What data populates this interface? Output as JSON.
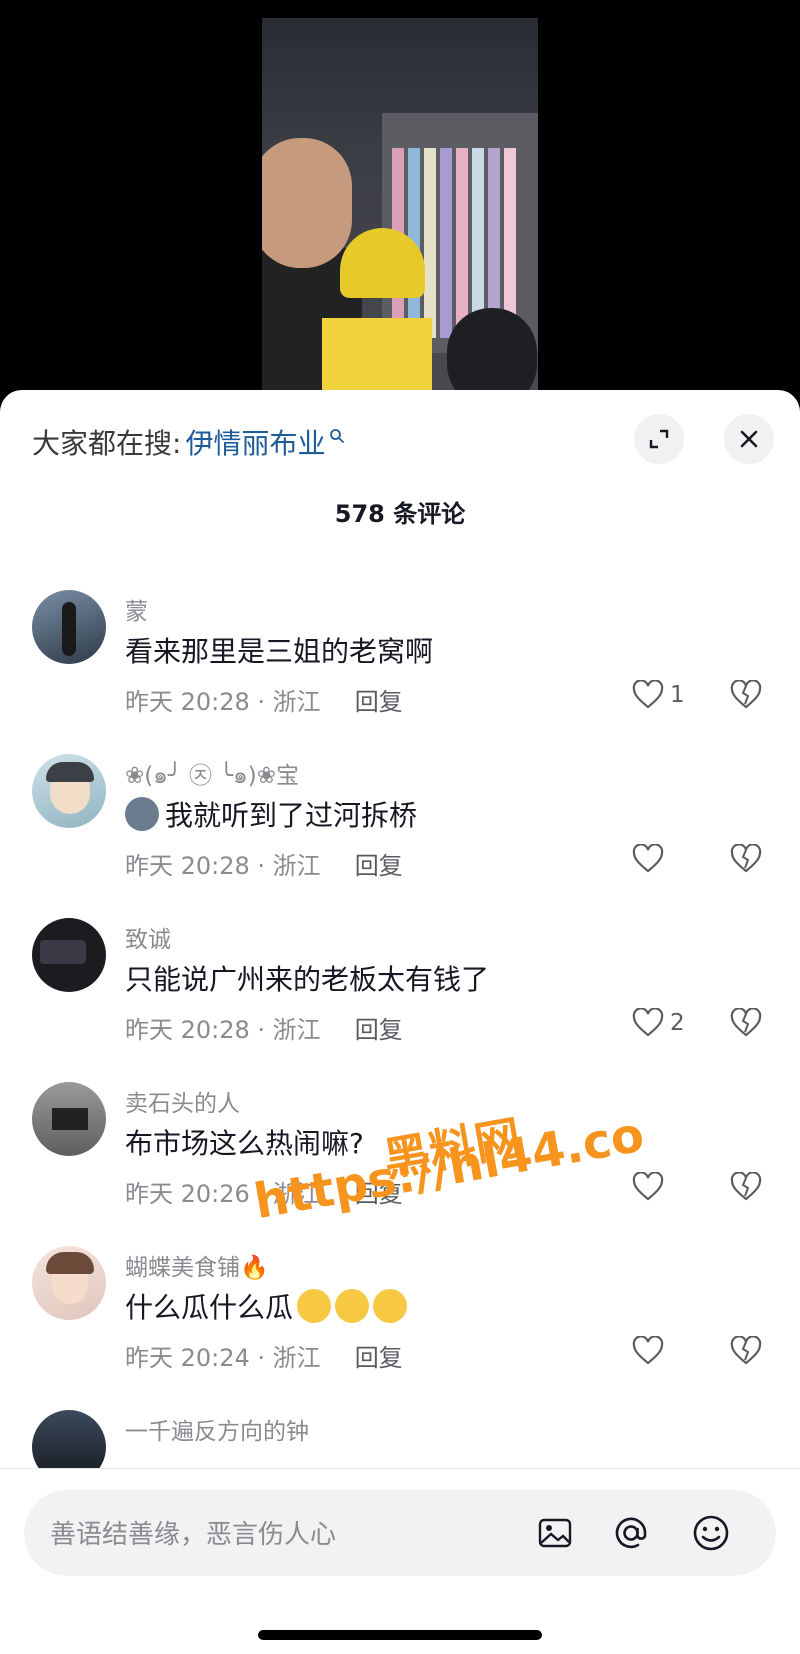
{
  "search": {
    "prefix": "大家都在搜:",
    "term": "伊情丽布业"
  },
  "header": {
    "title": "578 条评论"
  },
  "comments": [
    {
      "user": "蒙",
      "text": "看来那里是三姐的老窝啊",
      "time": "昨天 20:28 · 浙江",
      "reply": "回复",
      "likes": "1",
      "emojis": []
    },
    {
      "user": "❀(๑╯ ㉨ ╰๑)❀宝",
      "text": "我就听到了过河拆桥",
      "time": "昨天 20:28 · 浙江",
      "reply": "回复",
      "likes": "",
      "lead_emoji": "doge-emoji",
      "emojis": []
    },
    {
      "user": "致诚",
      "text": "只能说广州来的老板太有钱了",
      "time": "昨天 20:28 · 浙江",
      "reply": "回复",
      "likes": "2",
      "emojis": []
    },
    {
      "user": "卖石头的人",
      "text": "布市场这么热闹嘛?",
      "time": "昨天 20:26 · 浙江",
      "reply": "回复",
      "likes": "",
      "emojis": []
    },
    {
      "user": "蝴蝶美食铺🔥",
      "text": "什么瓜什么瓜",
      "time": "昨天 20:24 · 浙江",
      "reply": "回复",
      "likes": "",
      "emojis": [
        "grin-emoji",
        "grin-emoji",
        "grin-emoji"
      ]
    },
    {
      "user": "一千遍反方向的钟"
    }
  ],
  "input": {
    "placeholder": "善语结善缘，恶言伤人心"
  },
  "watermark": {
    "line1": "黑料网",
    "line2": "https://hl44.co"
  },
  "colors": {
    "link": "#1f5d99",
    "watermark": "#f7941d",
    "secondary_text": "#8a8b91"
  },
  "icons": [
    "search-icon",
    "expand-icon",
    "close-icon",
    "heart-icon",
    "broken-heart-icon",
    "image-icon",
    "at-icon",
    "smiley-icon"
  ]
}
